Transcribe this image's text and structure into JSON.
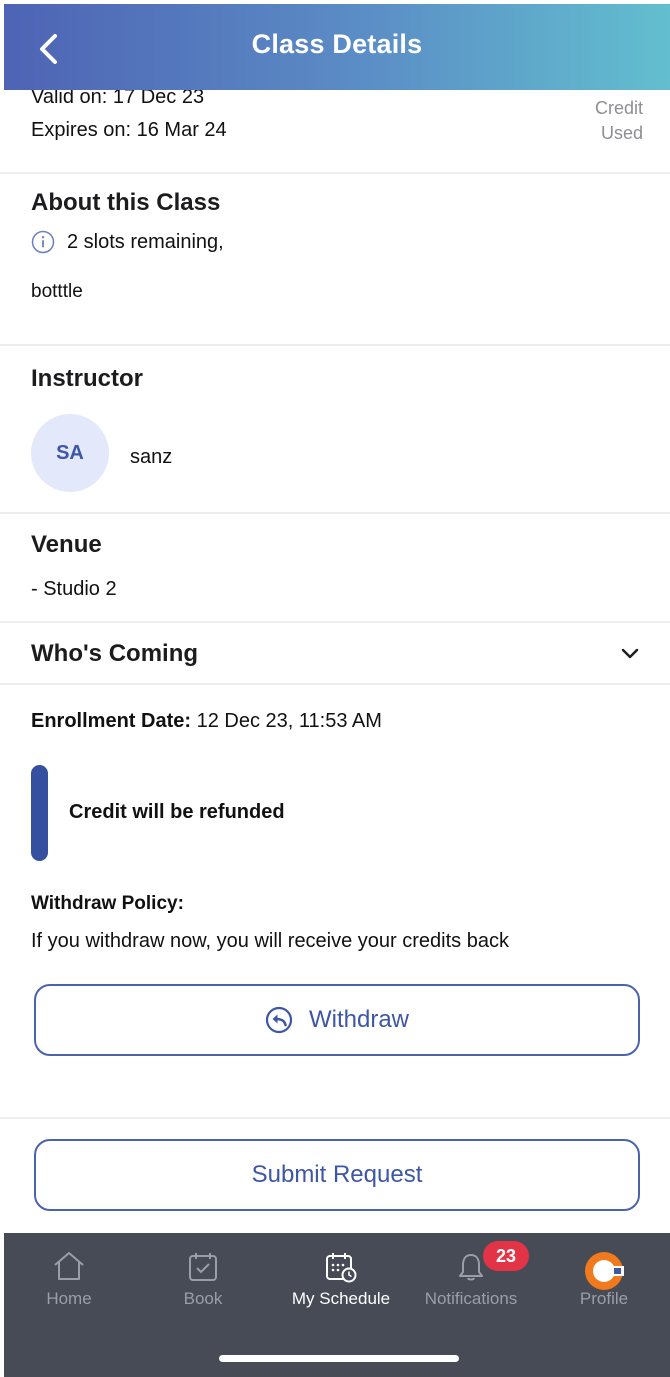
{
  "header": {
    "title": "Class Details"
  },
  "validity": {
    "valid_on": "Valid on: 17 Dec 23",
    "expires_on": "Expires on: 16 Mar 24",
    "credit_line1": "Credit",
    "credit_line2": "Used"
  },
  "about": {
    "title": "About this Class",
    "slots": "2 slots remaining,",
    "description": "botttle"
  },
  "instructor": {
    "title": "Instructor",
    "initials": "SA",
    "name": "sanz"
  },
  "venue": {
    "title": "Venue",
    "location": "- Studio 2"
  },
  "whos_coming": {
    "title": "Who's Coming"
  },
  "enrollment": {
    "label": "Enrollment Date:",
    "value": " 12 Dec 23, 11:53 AM"
  },
  "refund": {
    "text": "Credit will be refunded"
  },
  "policy": {
    "title": "Withdraw Policy:",
    "text": "If you withdraw now, you will receive your credits back"
  },
  "actions": {
    "withdraw_label": "Withdraw",
    "submit_label": "Submit Request"
  },
  "tabbar": {
    "home": "Home",
    "book": "Book",
    "schedule": "My Schedule",
    "notifications": "Notifications",
    "notifications_badge": "23",
    "profile": "Profile"
  },
  "colors": {
    "accent": "#3d56a6",
    "refund_bar": "#34509e",
    "badge": "#e23446",
    "tabbar_bg": "#474b55"
  }
}
